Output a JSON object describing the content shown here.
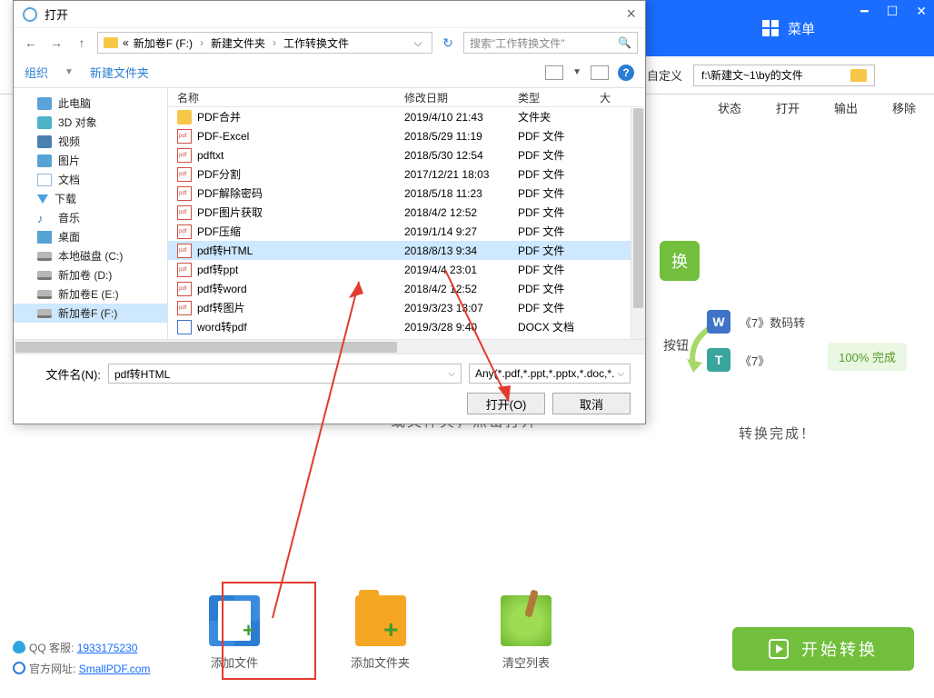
{
  "topbar": {
    "menu": "菜单"
  },
  "bg_header": {
    "label": "自定义",
    "path": "f:\\新建文~1\\by的文件"
  },
  "col_headers_bg": [
    "状态",
    "打开",
    "输出",
    "移除"
  ],
  "drop_hint": "或文件夹，点击打开",
  "convert_badge": "换",
  "button_text": "按钮",
  "preview": {
    "doc1": "《7》数码转",
    "doc2": "《7》",
    "done": "100%  完成",
    "caption": "转换完成！"
  },
  "actions": {
    "add_file": "添加文件",
    "add_folder": "添加文件夹",
    "clear": "清空列表"
  },
  "start_btn": "开始转换",
  "footer": {
    "qq_label": "QQ 客服:",
    "qq_link": "1933175230",
    "site_label": "官方网址:",
    "site_link": "SmallPDF.com"
  },
  "dialog": {
    "title": "打开",
    "path": {
      "seg1": "新加卷F (F:)",
      "seg2": "新建文件夹",
      "seg3": "工作转换文件"
    },
    "search_placeholder": "搜索\"工作转换文件\"",
    "toolbar": {
      "organize": "组织",
      "new_folder": "新建文件夹"
    },
    "tree": [
      {
        "label": "此电脑",
        "ic": "ic-pc"
      },
      {
        "label": "3D 对象",
        "ic": "ic-3d"
      },
      {
        "label": "视频",
        "ic": "ic-vid"
      },
      {
        "label": "图片",
        "ic": "ic-img"
      },
      {
        "label": "文档",
        "ic": "ic-doc"
      },
      {
        "label": "下载",
        "ic": "ic-dl"
      },
      {
        "label": "音乐",
        "ic": "ic-mus"
      },
      {
        "label": "桌面",
        "ic": "ic-desk"
      },
      {
        "label": "本地磁盘 (C:)",
        "ic": "ic-drive"
      },
      {
        "label": "新加卷 (D:)",
        "ic": "ic-drive"
      },
      {
        "label": "新加卷E (E:)",
        "ic": "ic-drive"
      },
      {
        "label": "新加卷F (F:)",
        "ic": "ic-drive",
        "sel": true
      }
    ],
    "columns": {
      "name": "名称",
      "date": "修改日期",
      "type": "类型",
      "size": "大"
    },
    "files": [
      {
        "n": "PDF合并",
        "d": "2019/4/10 21:43",
        "t": "文件夹",
        "ic": "f-folder"
      },
      {
        "n": "PDF-Excel",
        "d": "2018/5/29 11:19",
        "t": "PDF 文件",
        "ic": "f-pdf"
      },
      {
        "n": "pdftxt",
        "d": "2018/5/30 12:54",
        "t": "PDF 文件",
        "ic": "f-pdf"
      },
      {
        "n": "PDF分割",
        "d": "2017/12/21 18:03",
        "t": "PDF 文件",
        "ic": "f-pdf"
      },
      {
        "n": "PDF解除密码",
        "d": "2018/5/18 11:23",
        "t": "PDF 文件",
        "ic": "f-pdf"
      },
      {
        "n": "PDF图片获取",
        "d": "2018/4/2 12:52",
        "t": "PDF 文件",
        "ic": "f-pdf"
      },
      {
        "n": "PDF压缩",
        "d": "2019/1/14 9:27",
        "t": "PDF 文件",
        "ic": "f-pdf"
      },
      {
        "n": "pdf转HTML",
        "d": "2018/8/13 9:34",
        "t": "PDF 文件",
        "ic": "f-pdf",
        "sel": true
      },
      {
        "n": "pdf转ppt",
        "d": "2019/4/4 23:01",
        "t": "PDF 文件",
        "ic": "f-pdf"
      },
      {
        "n": "pdf转word",
        "d": "2018/4/2 12:52",
        "t": "PDF 文件",
        "ic": "f-pdf"
      },
      {
        "n": "pdf转图片",
        "d": "2019/3/23 13:07",
        "t": "PDF 文件",
        "ic": "f-pdf"
      },
      {
        "n": "word转pdf",
        "d": "2019/3/28 9:40",
        "t": "DOCX 文档",
        "ic": "f-doc"
      }
    ],
    "filename_label": "文件名(N):",
    "filename_value": "pdf转HTML",
    "filter": "Any(*.pdf,*.ppt,*.pptx,*.doc,*.",
    "open_btn": "打开(O)",
    "cancel_btn": "取消"
  }
}
